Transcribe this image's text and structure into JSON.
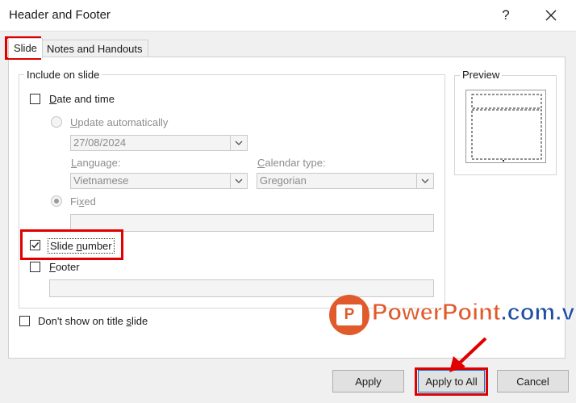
{
  "window": {
    "title": "Header and Footer",
    "help": "?",
    "close": "✕"
  },
  "tabs": [
    {
      "label": "Slide",
      "active": true
    },
    {
      "label": "Notes and Handouts",
      "active": false
    }
  ],
  "include": {
    "legend": "Include on slide",
    "date_time": {
      "label_u": "D",
      "label_rest": "ate and time",
      "checked": false
    },
    "update_auto": {
      "label_u": "U",
      "label_rest": "pdate automatically"
    },
    "date_value": "27/08/2024",
    "language": {
      "label_u": "L",
      "label_rest": "anguage:",
      "value": "Vietnamese"
    },
    "calendar": {
      "label_u": "C",
      "label_rest": "alendar type:",
      "value": "Gregorian"
    },
    "fixed": {
      "label_pre": "Fi",
      "label_u": "x",
      "label_rest": "ed"
    },
    "slide_number": {
      "label_pre": "Slide ",
      "label_u": "n",
      "label_rest": "umber",
      "checked": true
    },
    "footer": {
      "label_u": "F",
      "label_rest": "ooter",
      "checked": false
    }
  },
  "dont_show": {
    "label_pre": "Don't show on title ",
    "label_u": "s",
    "label_rest": "lide",
    "checked": false
  },
  "preview": {
    "legend": "Preview"
  },
  "buttons": {
    "apply": "Apply",
    "apply_all": "Apply to All",
    "cancel": "Cancel"
  },
  "watermark": {
    "brand": "PowerPoint",
    "suffix": ".com.vn",
    "logo_letter": "P"
  },
  "colors": {
    "highlight": "#e00000",
    "brand_orange": "#e05a2b",
    "brand_blue": "#1f4fa0"
  }
}
